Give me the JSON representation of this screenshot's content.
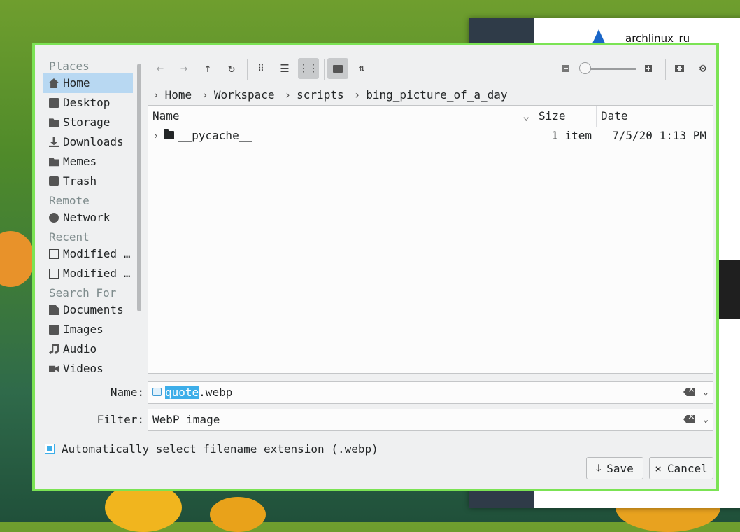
{
  "background": {
    "window_title": "archlinux_ru"
  },
  "sidebar": {
    "sections": [
      {
        "header": "Places",
        "items": [
          {
            "label": "Home",
            "icon": "home-icon",
            "active": true
          },
          {
            "label": "Desktop",
            "icon": "desktop-icon"
          },
          {
            "label": "Storage",
            "icon": "folder-icon"
          },
          {
            "label": "Downloads",
            "icon": "download-icon"
          },
          {
            "label": "Memes",
            "icon": "folder-icon"
          },
          {
            "label": "Trash",
            "icon": "trash-icon"
          }
        ]
      },
      {
        "header": "Remote",
        "items": [
          {
            "label": "Network",
            "icon": "network-icon"
          }
        ]
      },
      {
        "header": "Recent",
        "items": [
          {
            "label": "Modified …",
            "icon": "recent-files-icon"
          },
          {
            "label": "Modified …",
            "icon": "recent-folders-icon"
          }
        ]
      },
      {
        "header": "Search For",
        "items": [
          {
            "label": "Documents",
            "icon": "document-icon"
          },
          {
            "label": "Images",
            "icon": "image-icon"
          },
          {
            "label": "Audio",
            "icon": "audio-icon"
          },
          {
            "label": "Videos",
            "icon": "video-icon"
          }
        ]
      }
    ]
  },
  "breadcrumb": [
    "Home",
    "Workspace",
    "scripts",
    "bing_picture_of_a_day"
  ],
  "filelist": {
    "columns": {
      "name": "Name",
      "size": "Size",
      "date": "Date"
    },
    "rows": [
      {
        "name": "__pycache__",
        "size": "1 item",
        "date": "7/5/20 1:13 PM"
      }
    ]
  },
  "form": {
    "name_label": "Name:",
    "name_selected": "quote",
    "name_rest": ".webp",
    "filter_label": "Filter:",
    "filter_value": "WebP image",
    "auto_ext_label": "Automatically select filename extension (.webp)",
    "auto_ext_checked": true
  },
  "buttons": {
    "save": "Save",
    "cancel": "Cancel"
  },
  "colors": {
    "accent": "#3daee9",
    "dialog_border": "#7be354",
    "selection_bg": "#b8d8f2"
  }
}
